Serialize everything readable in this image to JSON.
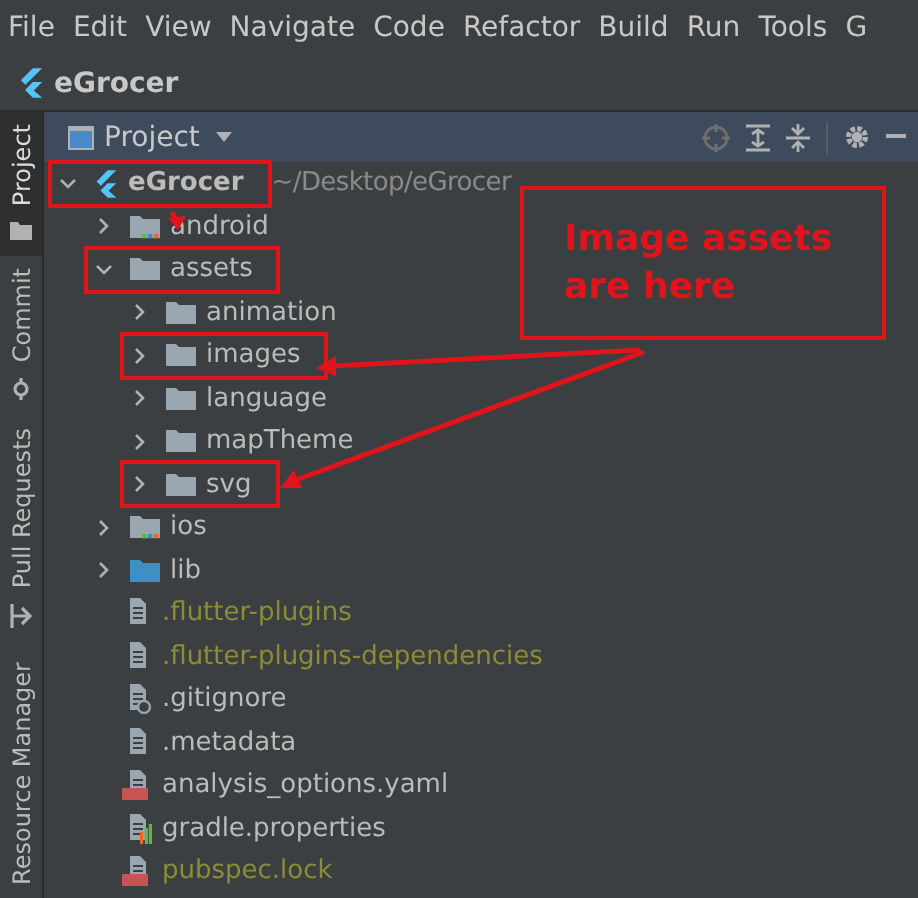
{
  "menu": [
    "File",
    "Edit",
    "View",
    "Navigate",
    "Code",
    "Refactor",
    "Build",
    "Run",
    "Tools",
    "G"
  ],
  "toolbar": {
    "project_name": "eGrocer"
  },
  "side_tabs": [
    {
      "label": "Project",
      "selected": true,
      "kind": "project"
    },
    {
      "label": "Commit",
      "selected": false,
      "kind": "commit"
    },
    {
      "label": "Pull Requests",
      "selected": false,
      "kind": "pull"
    },
    {
      "label": "Resource Manager",
      "selected": false,
      "kind": "none"
    }
  ],
  "panel": {
    "title": "Project"
  },
  "tree": {
    "label": "eGrocer",
    "detail": "~/Desktop/eGrocer",
    "kind": "module",
    "expanded": true,
    "annotated": true,
    "ignored": false,
    "children": [
      {
        "label": "android",
        "kind": "android-folder",
        "expanded": false,
        "annotated": false,
        "ignored": false
      },
      {
        "label": "assets",
        "kind": "folder",
        "expanded": true,
        "annotated": true,
        "ignored": false,
        "children": [
          {
            "label": "animation",
            "kind": "folder",
            "expanded": false,
            "annotated": false,
            "ignored": false
          },
          {
            "label": "images",
            "kind": "folder",
            "expanded": false,
            "annotated": true,
            "ignored": false
          },
          {
            "label": "language",
            "kind": "folder",
            "expanded": false,
            "annotated": false,
            "ignored": false
          },
          {
            "label": "mapTheme",
            "kind": "folder",
            "expanded": false,
            "annotated": false,
            "ignored": false
          },
          {
            "label": "svg",
            "kind": "folder",
            "expanded": false,
            "annotated": true,
            "ignored": false
          }
        ]
      },
      {
        "label": "ios",
        "kind": "ios-folder",
        "expanded": false,
        "annotated": false,
        "ignored": false
      },
      {
        "label": "lib",
        "kind": "source-folder",
        "expanded": false,
        "annotated": false,
        "ignored": false
      },
      {
        "label": ".flutter-plugins",
        "kind": "file",
        "annotated": false,
        "ignored": true
      },
      {
        "label": ".flutter-plugins-dependencies",
        "kind": "file",
        "annotated": false,
        "ignored": true
      },
      {
        "label": ".gitignore",
        "kind": "ignore-file",
        "annotated": false,
        "ignored": false
      },
      {
        "label": ".metadata",
        "kind": "file",
        "annotated": false,
        "ignored": false
      },
      {
        "label": "analysis_options.yaml",
        "kind": "yaml-file",
        "annotated": false,
        "ignored": false
      },
      {
        "label": "gradle.properties",
        "kind": "properties-file",
        "annotated": false,
        "ignored": false
      },
      {
        "label": "pubspec.lock",
        "kind": "yaml-file",
        "annotated": false,
        "ignored": true
      }
    ]
  },
  "callout": {
    "text": "Image assets are here"
  }
}
